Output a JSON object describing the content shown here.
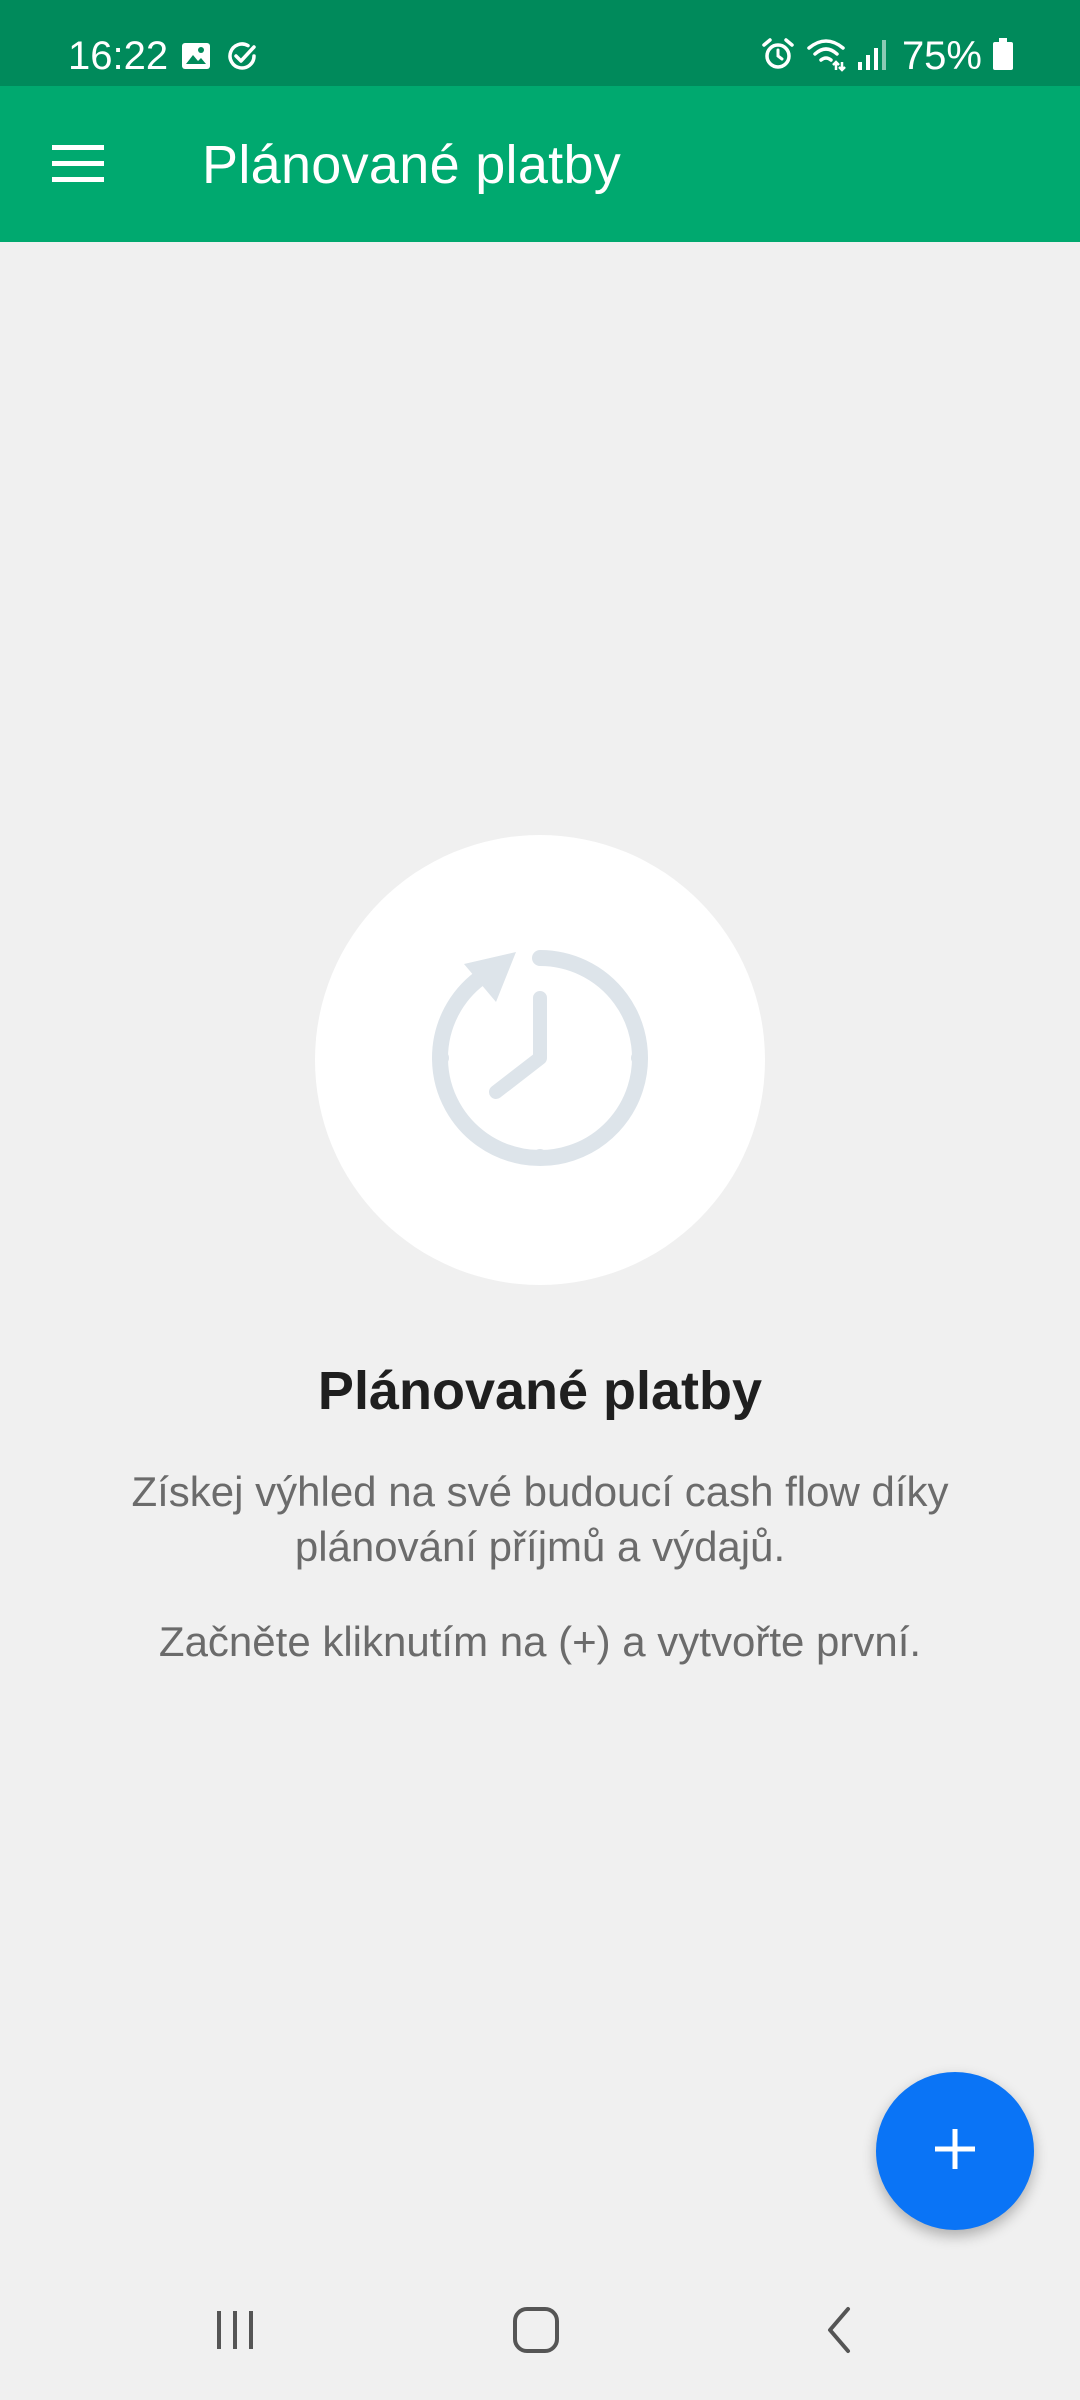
{
  "status_bar": {
    "time": "16:22",
    "battery": "75%",
    "icons": [
      "image-icon",
      "check-circle-icon",
      "alarm-icon",
      "wifi-icon",
      "signal-icon",
      "battery-icon"
    ]
  },
  "app_bar": {
    "title": "Plánované platby",
    "menu_icon": "hamburger-menu-icon"
  },
  "empty_state": {
    "icon": "scheduled-clock-icon",
    "title": "Plánované platby",
    "description": "Získej výhled na své budoucí cash flow díky plánování příjmů a výdajů.",
    "hint": "Začněte kliknutím na (+) a vytvořte první."
  },
  "fab": {
    "icon": "plus-icon"
  },
  "nav_bar": {
    "buttons": [
      "recent-apps-icon",
      "home-icon",
      "back-icon"
    ]
  },
  "colors": {
    "status_bar": "#008a5b",
    "app_bar": "#00a96f",
    "background": "#f0f0f0",
    "fab": "#0a74f6",
    "empty_icon": "#dde4ea"
  }
}
